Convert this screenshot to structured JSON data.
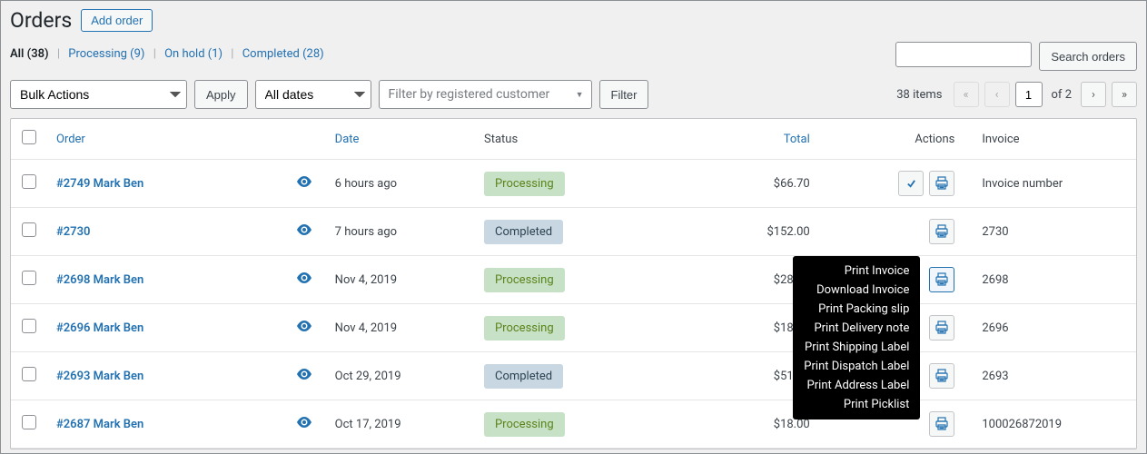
{
  "header": {
    "title": "Orders",
    "add_button": "Add order"
  },
  "filters": {
    "all_label": "All",
    "all_count": "(38)",
    "processing_label": "Processing",
    "processing_count": "(9)",
    "onhold_label": "On hold",
    "onhold_count": "(1)",
    "completed_label": "Completed",
    "completed_count": "(28)"
  },
  "search": {
    "button_label": "Search orders"
  },
  "toolbar": {
    "bulk_selected": "Bulk Actions",
    "apply_label": "Apply",
    "dates_selected": "All dates",
    "customer_placeholder": "Filter by registered customer",
    "filter_label": "Filter"
  },
  "pagination": {
    "items_text": "38 items",
    "current_page": "1",
    "of_label": "of",
    "total_pages": "2"
  },
  "columns": {
    "order": "Order",
    "date": "Date",
    "status": "Status",
    "total": "Total",
    "actions": "Actions",
    "invoice": "Invoice"
  },
  "rows": [
    {
      "order": "#2749 Mark Ben",
      "date": "6 hours ago",
      "status": "Processing",
      "status_class": "status-processing",
      "total": "$66.70",
      "invoice": "Invoice number",
      "has_check": true,
      "dropdown": false,
      "print_active": false
    },
    {
      "order": "#2730",
      "date": "7 hours ago",
      "status": "Completed",
      "status_class": "status-completed",
      "total": "$152.00",
      "invoice": "2730",
      "has_check": false,
      "dropdown": false,
      "print_active": false
    },
    {
      "order": "#2698 Mark Ben",
      "date": "Nov 4, 2019",
      "status": "Processing",
      "status_class": "status-processing",
      "total": "$28.75",
      "invoice": "2698",
      "has_check": false,
      "dropdown": true,
      "print_active": true
    },
    {
      "order": "#2696 Mark Ben",
      "date": "Nov 4, 2019",
      "status": "Processing",
      "status_class": "status-processing",
      "total": "$18.40",
      "invoice": "2696",
      "has_check": false,
      "dropdown": false,
      "print_active": false
    },
    {
      "order": "#2693 Mark Ben",
      "date": "Oct 29, 2019",
      "status": "Completed",
      "status_class": "status-completed",
      "total": "$51.75",
      "invoice": "2693",
      "has_check": false,
      "dropdown": false,
      "print_active": false
    },
    {
      "order": "#2687 Mark Ben",
      "date": "Oct 17, 2019",
      "status": "Processing",
      "status_class": "status-processing",
      "total": "$18.00",
      "invoice": "100026872019",
      "has_check": false,
      "dropdown": false,
      "print_active": false
    }
  ],
  "dropdown_items": {
    "print_invoice": "Print Invoice",
    "download_invoice": "Download Invoice",
    "print_packing_slip": "Print Packing slip",
    "print_delivery_note": "Print Delivery note",
    "print_shipping_label": "Print Shipping Label",
    "print_dispatch_label": "Print Dispatch Label",
    "print_address_label": "Print Address Label",
    "print_picklist": "Print Picklist"
  }
}
